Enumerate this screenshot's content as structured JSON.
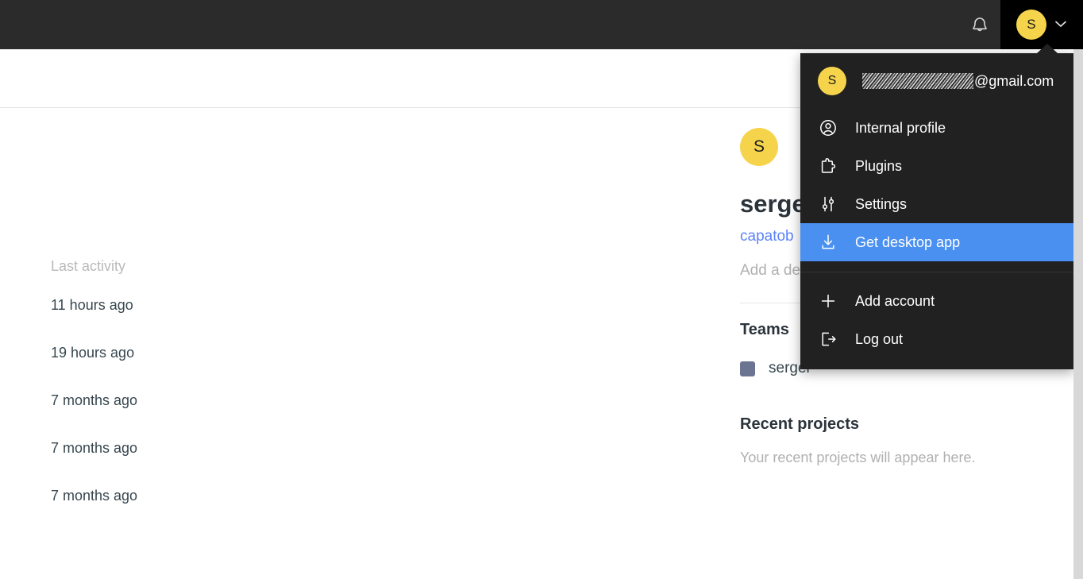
{
  "topbar": {
    "notifications_icon": "bell-icon",
    "avatar_initial": "S",
    "chevron_icon": "chevron-down-icon"
  },
  "activity": {
    "header": "Last activity",
    "rows": [
      "11 hours ago",
      "19 hours ago",
      "7 months ago",
      "7 months ago",
      "7 months ago"
    ]
  },
  "profile": {
    "avatar_initial": "S",
    "name": "serge",
    "handle": "capatob",
    "description_placeholder": "Add a de",
    "teams_title": "Teams",
    "teams": [
      {
        "name": "sergei",
        "color": "#6b7490"
      }
    ],
    "recent_projects_title": "Recent projects",
    "recent_projects_empty": "Your recent projects will appear here."
  },
  "account_menu": {
    "avatar_initial": "S",
    "email_domain": "@gmail.com",
    "email_redacted": true,
    "items": [
      {
        "label": "Internal profile",
        "icon": "user-circle-icon",
        "active": false
      },
      {
        "label": "Plugins",
        "icon": "puzzle-piece-icon",
        "active": false
      },
      {
        "label": "Settings",
        "icon": "sliders-icon",
        "active": false
      },
      {
        "label": "Get desktop app",
        "icon": "download-icon",
        "active": true
      }
    ],
    "footer_items": [
      {
        "label": "Add account",
        "icon": "plus-icon"
      },
      {
        "label": "Log out",
        "icon": "logout-icon"
      }
    ],
    "highlight_color": "#4a90f0",
    "background_color": "#212121"
  }
}
